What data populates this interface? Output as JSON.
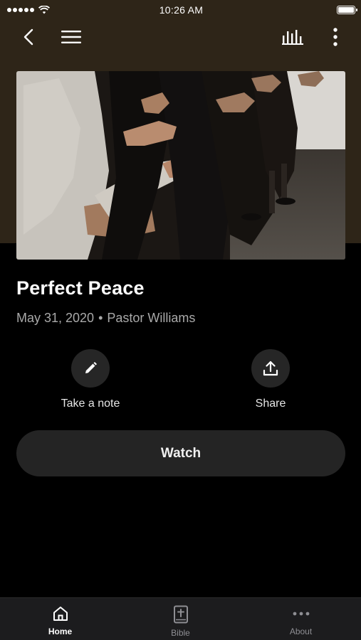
{
  "status_bar": {
    "time": "10:26 AM",
    "signal_icon": "signal-dots-icon",
    "wifi_icon": "wifi-icon",
    "battery_icon": "battery-icon"
  },
  "nav": {
    "back_icon": "chevron-left-icon",
    "menu_icon": "hamburger-menu-icon",
    "audio_icon": "audio-bars-icon",
    "more_icon": "vertical-dots-icon"
  },
  "hero": {
    "image_description_icon": "sermon-hero-image"
  },
  "sermon": {
    "title": "Perfect Peace",
    "date": "May 31, 2020",
    "separator": "•",
    "speaker": "Pastor Williams"
  },
  "actions": {
    "note_label": "Take a note",
    "share_label": "Share",
    "note_icon": "pencil-icon",
    "share_icon": "share-icon"
  },
  "watch": {
    "label": "Watch"
  },
  "tabs": [
    {
      "label": "Home",
      "icon": "home-icon",
      "active": true
    },
    {
      "label": "Bible",
      "icon": "bible-icon",
      "active": false
    },
    {
      "label": "About",
      "icon": "more-horizontal-icon",
      "active": false
    }
  ],
  "colors": {
    "header_bg": "#2e2518",
    "background": "#000000",
    "button_bg": "#242424",
    "meta_text": "#a9a9a9",
    "tab_bar_bg": "#1c1c1e"
  }
}
